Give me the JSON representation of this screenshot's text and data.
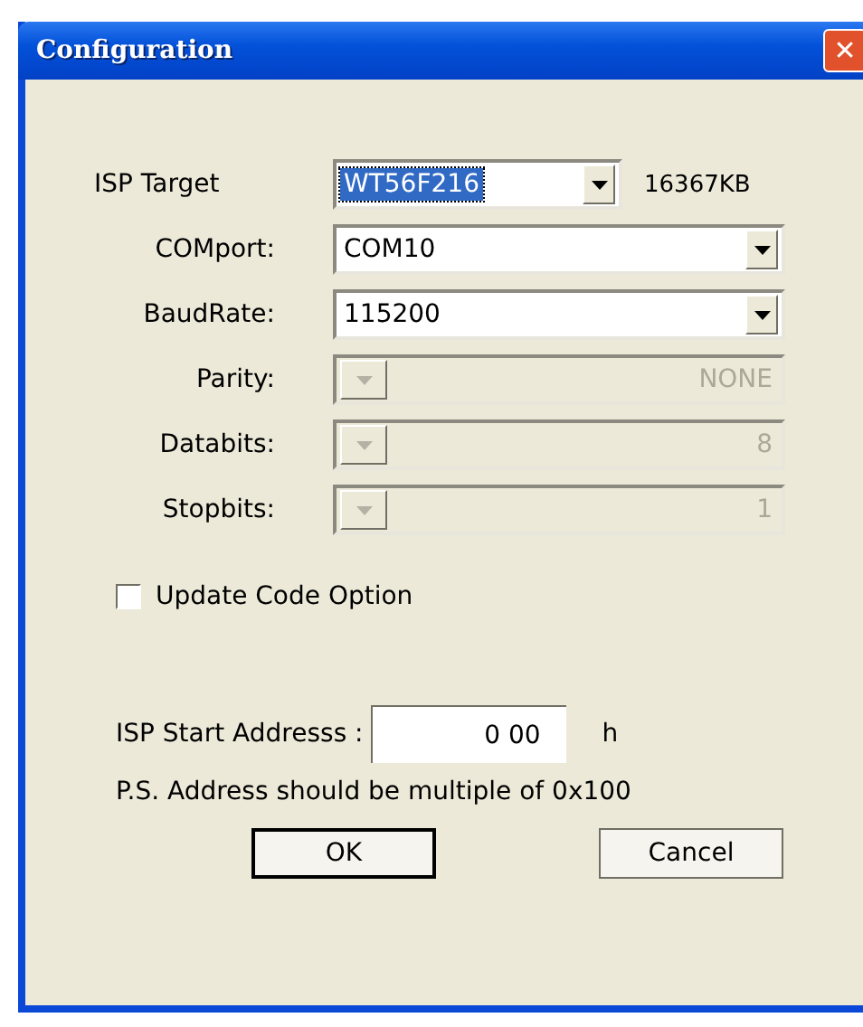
{
  "window": {
    "title": "Configuration",
    "close": "✕"
  },
  "isp_target": {
    "label": "ISP Target",
    "value": "WT56F216",
    "focused": true,
    "size": "16367KB"
  },
  "fields": [
    {
      "label": "COMport:",
      "value": "COM10",
      "disabled": false
    },
    {
      "label": "BaudRate:",
      "value": "115200",
      "disabled": false
    },
    {
      "label": "Parity:",
      "value": "NONE",
      "disabled": true
    },
    {
      "label": "Databits:",
      "value": "8",
      "disabled": true
    },
    {
      "label": "Stopbits:",
      "value": "1",
      "disabled": true
    }
  ],
  "update_option": {
    "label": "Update Code Option",
    "checked": false
  },
  "start_address": {
    "label": "ISP Start Addresss :",
    "value": "0 00",
    "unit": "h"
  },
  "note": "P.S. Address should be multiple of 0x100",
  "buttons": [
    {
      "label": "OK",
      "default": true
    },
    {
      "label": "Cancel",
      "default": false
    }
  ]
}
